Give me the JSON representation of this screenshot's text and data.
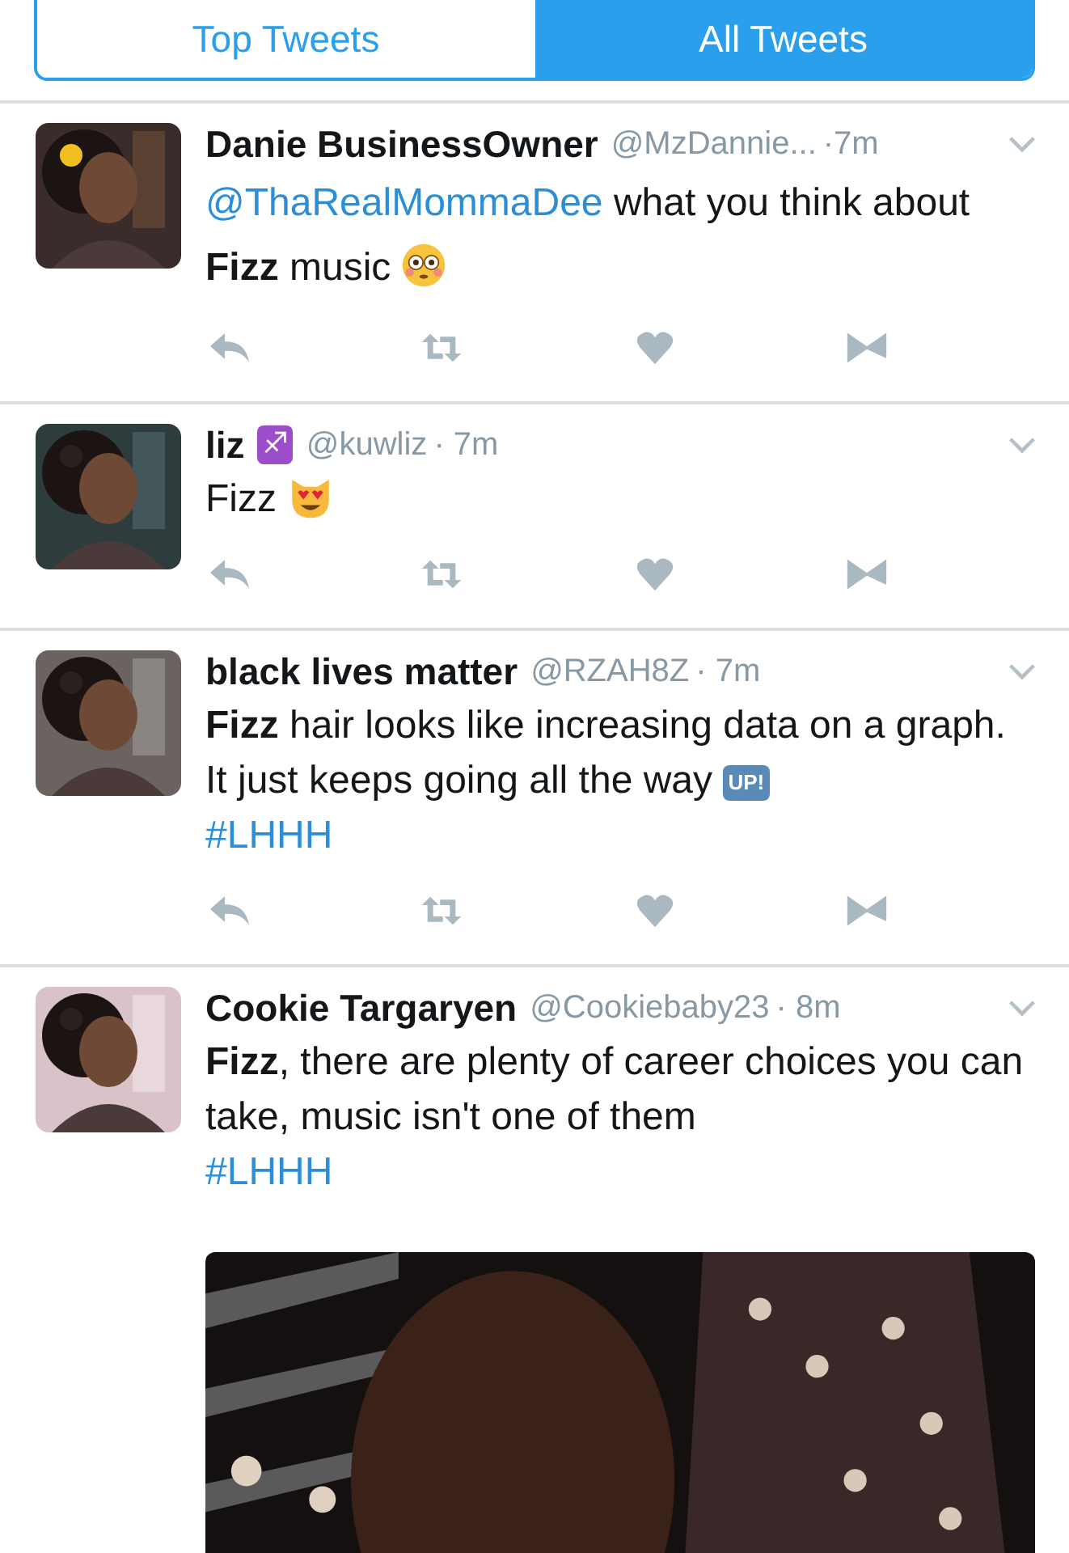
{
  "tabs": [
    {
      "label": "Top Tweets",
      "selected": false
    },
    {
      "label": "All Tweets",
      "selected": true
    }
  ],
  "tweets": [
    {
      "name": "Danie BusinessOwner",
      "handle": "@MzDannie...",
      "time": "·7m",
      "body": [
        {
          "kind": "link",
          "text": "@ThaRealMommaDee"
        },
        {
          "kind": "text",
          "text": " what you think about **Fizz** music "
        },
        {
          "kind": "flushed-emoji"
        }
      ]
    },
    {
      "name": "liz",
      "badge": "♐",
      "handle": "@kuwliz",
      "time": "· 7m",
      "body": [
        {
          "kind": "text",
          "text": "Fizz "
        },
        {
          "kind": "heart-eyes-cat-emoji"
        }
      ]
    },
    {
      "name": "black lives matter",
      "handle": "@RZAH8Z",
      "time": "· 7m",
      "body": [
        {
          "kind": "text",
          "text": "**Fizz** hair looks like increasing data on a graph. It just keeps going all the way "
        },
        {
          "kind": "up-badge",
          "text": "UP!"
        },
        {
          "kind": "link",
          "text": "#LHHH",
          "newline": true
        }
      ]
    },
    {
      "name": "Cookie Targaryen",
      "handle": "@Cookiebaby23",
      "time": "· 8m",
      "body": [
        {
          "kind": "text",
          "text": "**Fizz**, there are plenty of career choices you can take, music isn't one of them"
        },
        {
          "kind": "link",
          "text": "#LHHH",
          "newline": true
        }
      ],
      "media": {
        "kind": "picture"
      }
    }
  ]
}
